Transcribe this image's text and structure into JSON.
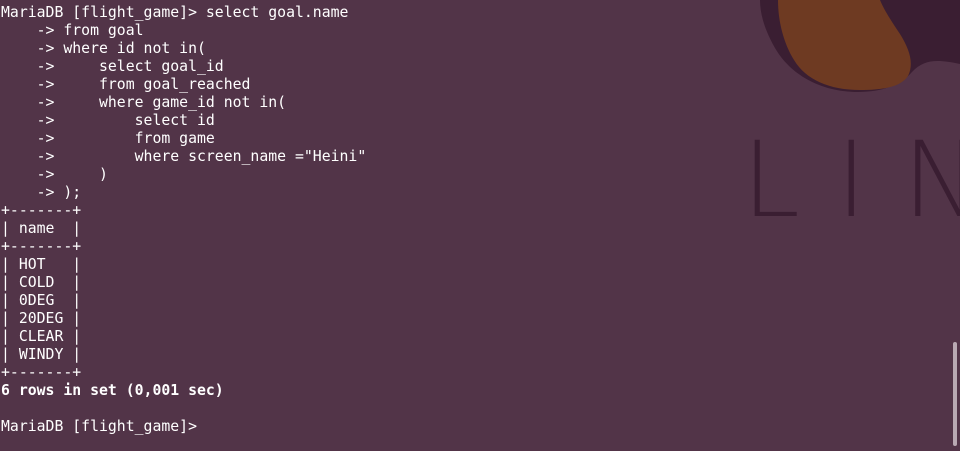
{
  "terminal": {
    "lines": [
      {
        "text": "MariaDB [flight_game]> select goal.name",
        "bold": false
      },
      {
        "text": "    -> from goal",
        "bold": false
      },
      {
        "text": "    -> where id not in(",
        "bold": false
      },
      {
        "text": "    ->     select goal_id",
        "bold": false
      },
      {
        "text": "    ->     from goal_reached",
        "bold": false
      },
      {
        "text": "    ->     where game_id not in(",
        "bold": false
      },
      {
        "text": "    ->         select id",
        "bold": false
      },
      {
        "text": "    ->         from game",
        "bold": false
      },
      {
        "text": "    ->         where screen_name =\"Heini\"",
        "bold": false
      },
      {
        "text": "    ->     )",
        "bold": false
      },
      {
        "text": "    -> );",
        "bold": false
      },
      {
        "text": "+-------+",
        "bold": false
      },
      {
        "text": "| name  |",
        "bold": false
      },
      {
        "text": "+-------+",
        "bold": false
      },
      {
        "text": "| HOT   |",
        "bold": false
      },
      {
        "text": "| COLD  |",
        "bold": false
      },
      {
        "text": "| 0DEG  |",
        "bold": false
      },
      {
        "text": "| 20DEG |",
        "bold": false
      },
      {
        "text": "| CLEAR |",
        "bold": false
      },
      {
        "text": "| WINDY |",
        "bold": false
      },
      {
        "text": "+-------+",
        "bold": false
      },
      {
        "text": "6 rows in set (0,001 sec)",
        "bold": true
      },
      {
        "text": "",
        "bold": false
      },
      {
        "text": "MariaDB [flight_game]> ",
        "bold": false
      }
    ]
  },
  "wallpaper": {
    "text": "LIN",
    "colors": {
      "background": "#523448",
      "shape_dark": "#3a1e32",
      "shape_brown": "#6e3a22",
      "shape_light": "#6b4c5f"
    }
  },
  "colors": {
    "text": "#ffffff",
    "scrollbar_thumb": "#b9a9b3"
  }
}
